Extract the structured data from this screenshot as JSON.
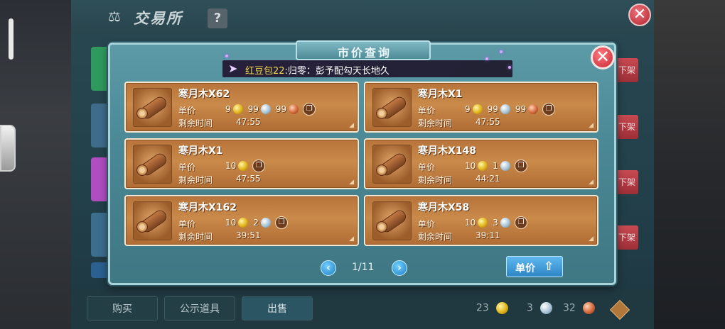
{
  "base_window": {
    "title": "交易所",
    "help_label": "?",
    "close_label": "✕",
    "shelf_button_label": "下架",
    "tabs": [
      {
        "label": "购买"
      },
      {
        "label": "公示道具"
      },
      {
        "label": "出售"
      }
    ],
    "currency": {
      "gold": "23",
      "silver": "3",
      "copper": "32"
    },
    "icons": {
      "scale": "scale-icon",
      "plus": "plus-icon"
    }
  },
  "dialog": {
    "title": "市价查询",
    "close_label": "✕",
    "marquee": {
      "speaker": "红豆包22",
      "message": ":归零：彭予配勾天长地久"
    },
    "labels": {
      "unit_price": "单价",
      "remaining_time": "剩余时间"
    },
    "listings": [
      {
        "name": "寒月木X62",
        "gold": "9",
        "silver": "99",
        "copper": "99",
        "time": "47:55"
      },
      {
        "name": "寒月木X1",
        "gold": "9",
        "silver": "99",
        "copper": "99",
        "time": "47:55"
      },
      {
        "name": "寒月木X1",
        "gold": "10",
        "time": "47:55"
      },
      {
        "name": "寒月木X148",
        "gold": "10",
        "silver": "1",
        "time": "44:21"
      },
      {
        "name": "寒月木X162",
        "gold": "10",
        "silver": "2",
        "time": "39:51"
      },
      {
        "name": "寒月木X58",
        "gold": "10",
        "silver": "3",
        "time": "39:11"
      }
    ],
    "pagination": {
      "text": "1/11",
      "prev_label": "‹",
      "next_label": "›"
    },
    "sort_button_label": "单价",
    "colors": {
      "card": "#c98a4a",
      "panel": "#4a8794",
      "accent_blue": "#2f85c6"
    }
  }
}
